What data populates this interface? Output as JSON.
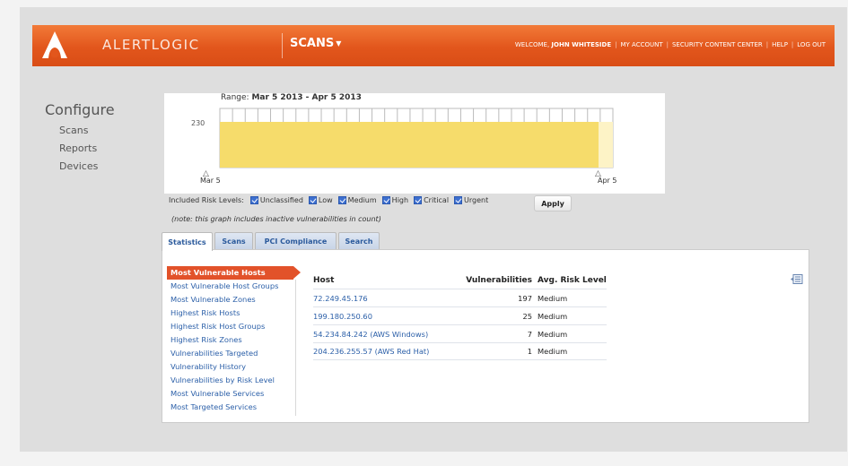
{
  "header": {
    "brand": "ALERTLOGIC",
    "nav_scans": "SCANS",
    "welcome_prefix": "WELCOME,",
    "user_name": "JOHN WHITESIDE",
    "links": [
      "MY ACCOUNT",
      "SECURITY CONTENT CENTER",
      "HELP",
      "LOG OUT"
    ]
  },
  "sidebar": {
    "title": "Configure",
    "items": [
      "Scans",
      "Reports",
      "Devices"
    ]
  },
  "chart_data": {
    "type": "area",
    "range_label": "Range:",
    "range_value": "Mar 5 2013 - Apr 5 2013",
    "x": [
      "Mar 5",
      "Apr 5"
    ],
    "values": [
      230,
      230
    ],
    "ytick": "230",
    "colors": {
      "fill": "#f6dc6b",
      "fill_light": "#fdf3c6"
    }
  },
  "risk_filter": {
    "label": "Included Risk Levels:",
    "levels": [
      "Unclassified",
      "Low",
      "Medium",
      "High",
      "Critical",
      "Urgent"
    ],
    "apply": "Apply",
    "note": "(note: this graph includes inactive vulnerabilities in count)"
  },
  "tabs": [
    "Statistics",
    "Scans",
    "PCI Compliance",
    "Search"
  ],
  "reports": {
    "items": [
      "Most Vulnerable Hosts",
      "Most Vulnerable Host Groups",
      "Most Vulnerable Zones",
      "Highest Risk Hosts",
      "Highest Risk Host Groups",
      "Highest Risk Zones",
      "Vulnerabilities Targeted",
      "Vulnerability History",
      "Vulnerabilities by Risk Level",
      "Most Vulnerable Services",
      "Most Targeted Services"
    ]
  },
  "table": {
    "headers": [
      "Host",
      "Vulnerabilities",
      "Avg. Risk Level"
    ],
    "rows": [
      [
        "72.249.45.176",
        "197",
        "Medium"
      ],
      [
        "199.180.250.60",
        "25",
        "Medium"
      ],
      [
        "54.234.84.242 (AWS Windows)",
        "7",
        "Medium"
      ],
      [
        "204.236.255.57 (AWS Red Hat)",
        "1",
        "Medium"
      ]
    ]
  },
  "colors": {
    "header_orange": "#e2561c",
    "active_item": "#e2522a",
    "link_blue": "#2b5fa8"
  }
}
